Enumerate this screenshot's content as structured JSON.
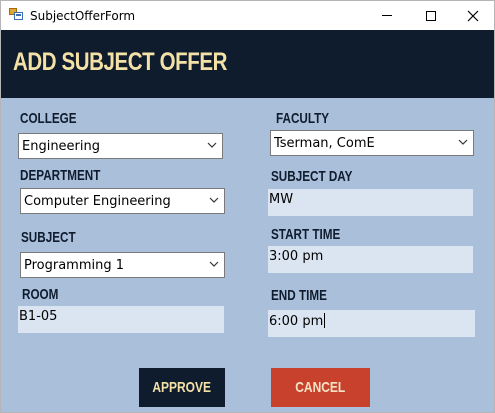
{
  "window": {
    "title": "SubjectOfferForm",
    "controls": {
      "minimize": "minimize-icon",
      "maximize": "maximize-icon",
      "close": "close-icon"
    }
  },
  "header": {
    "title": "ADD SUBJECT OFFER"
  },
  "form": {
    "college": {
      "label": "COLLEGE",
      "value": "Engineering"
    },
    "department": {
      "label": "DEPARTMENT",
      "value": "Computer Engineering"
    },
    "subject": {
      "label": "SUBJECT",
      "value": "Programming 1"
    },
    "room": {
      "label": "ROOM",
      "value": "B1-05"
    },
    "faculty": {
      "label": "FACULTY",
      "value": "Tserman, ComE"
    },
    "subject_day": {
      "label": "SUBJECT DAY",
      "value": "MW"
    },
    "start_time": {
      "label": "START TIME",
      "value": "3:00 pm"
    },
    "end_time": {
      "label": "END TIME",
      "value": "6:00 pm"
    }
  },
  "buttons": {
    "approve": "APPROVE",
    "cancel": "CANCEL"
  },
  "colors": {
    "header_bg": "#0f1c2e",
    "accent_text": "#f3e1a6",
    "form_bg": "#a9bfda",
    "textbox_bg": "#dbe5f2",
    "cancel_bg": "#c8412c"
  }
}
